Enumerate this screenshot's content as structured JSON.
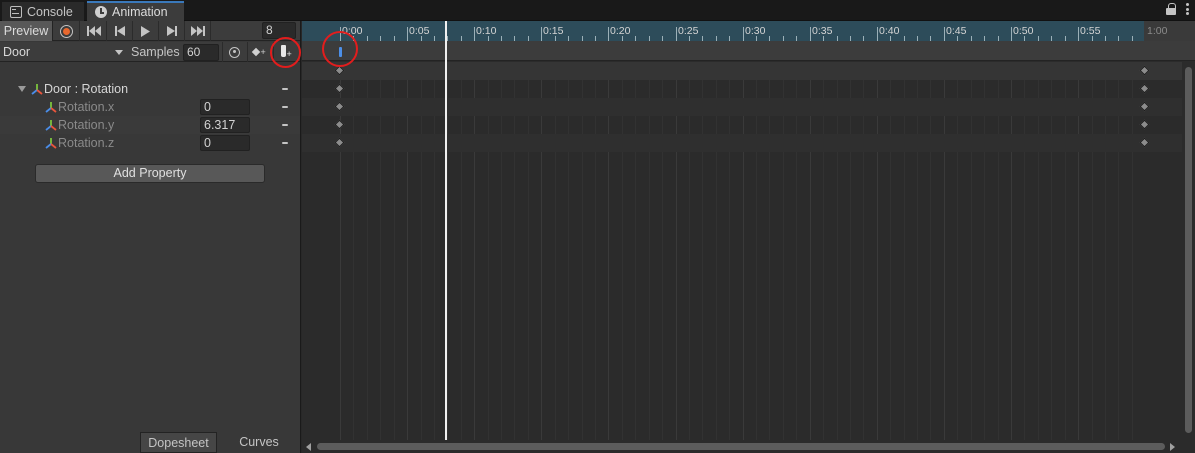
{
  "tabs": [
    {
      "label": "Console",
      "icon": "console-icon",
      "active": false
    },
    {
      "label": "Animation",
      "icon": "clock-icon",
      "active": true
    }
  ],
  "toolbar": {
    "preview_label": "Preview",
    "current_frame": "8",
    "record_color": "#e8682e"
  },
  "clip": {
    "name": "Door",
    "samples_label": "Samples",
    "samples_value": "60"
  },
  "properties": {
    "group_label": "Door : Rotation",
    "items": [
      {
        "label": "Rotation.x",
        "value": "0"
      },
      {
        "label": "Rotation.y",
        "value": "6.317"
      },
      {
        "label": "Rotation.z",
        "value": "0"
      }
    ],
    "add_button_label": "Add Property"
  },
  "bottom_tabs": {
    "dopesheet": "Dopesheet",
    "curves": "Curves"
  },
  "timeline": {
    "ruler_labels": [
      "0:00",
      "0:05",
      "0:10",
      "0:15",
      "0:20",
      "0:25",
      "0:30",
      "0:35",
      "0:40",
      "0:45",
      "0:50",
      "0:55",
      "1:00"
    ],
    "keyframes_at": [
      "0:00",
      "1:00"
    ],
    "playhead_frame": 8,
    "event_marker_color": "#4c8fe8",
    "ruler_color": "#2d4c5a"
  },
  "annotations": {
    "highlight_color": "#e21d1d"
  }
}
